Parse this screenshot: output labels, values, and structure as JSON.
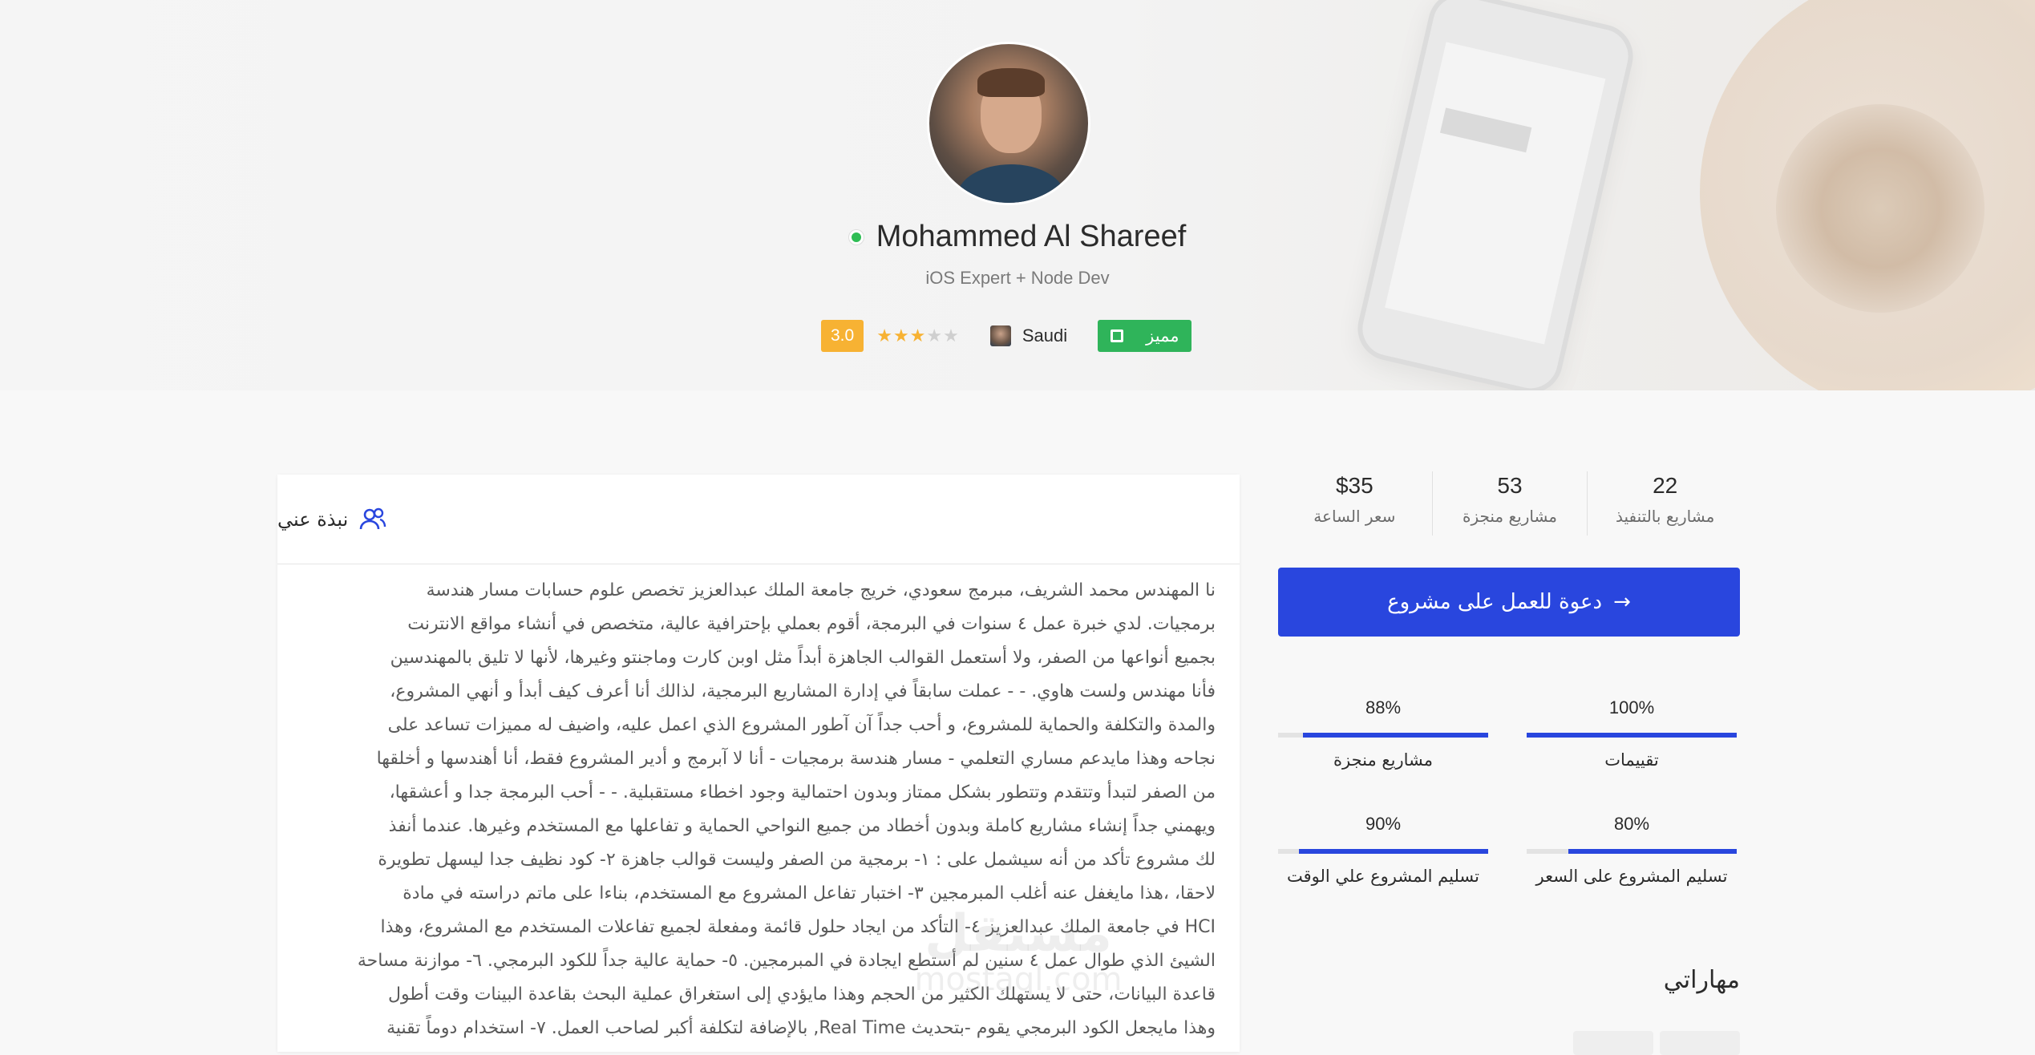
{
  "profile": {
    "name": "Mohammed Al Shareef",
    "title": "iOS Expert + Node Dev",
    "rating": "3.0",
    "stars_filled": 3,
    "stars_total": 5,
    "country": "Saudi",
    "badge": "مميز"
  },
  "about": {
    "title": "نبذة عني",
    "lines": [
      "نا المهندس محمد الشريف، مبرمج سعودي، خريج جامعة الملك عبدالعزيز تخصص علوم حسابات مسار هندسة",
      "برمجيات. لدي خبرة عمل ٤ سنوات في البرمجة، أقوم بعملي بإحترافية عالية، متخصص في أنشاء مواقع الانترنت",
      "بجميع أنواعها من الصفر، ولا أستعمل القوالب الجاهزة أبداً مثل اوبن كارت وماجنتو وغيرها، لأنها لا تليق بالمهندسين",
      "فأنا مهندس ولست هاوي. - - عملت سابقاً في إدارة المشاريع البرمجية، لذالك أنا أعرف كيف أبدأ و أنهي المشروع،",
      "والمدة والتكلفة والحماية للمشروع، و أحب جداً آن آطور المشروع الذي اعمل عليه، واضيف له مميزات تساعد على",
      "نجاحه وهذا مايدعم مساري التعلمي - مسار هندسة برمجيات - أنا لا آبرمج و أدير المشروع فقط، أنا أهندسها و أخلقها",
      "من الصفر لتبدأ وتتقدم وتتطور بشكل ممتاز وبدون احتمالية وجود اخطاء مستقبلية. - - أحب البرمجة جدا و أعشقها،",
      "ويهمني جداً إنشاء مشاريع كاملة وبدون أخطاد من جميع النواحي الحماية و تفاعلها مع المستخدم وغيرها. عندما أنفذ",
      "لك مشروع تأكد من أنه سيشمل على : ١- برمجية من الصفر وليست قوالب جاهزة ٢- كود نظيف جدا ليسهل تطويرة",
      "لاحقا، ،هذا مايغفل عنه أغلب المبرمجين ٣- اختبار تفاعل المشروع مع المستخدم، بناءا على ماتم دراسته في مادة",
      "HCI في جامعة الملك عبدالعزيز ٤- التأكد من ايجاد حلول قائمة ومفعلة لجميع تفاعلات المستخدم مع المشروع، وهذا",
      "الشيئ الذي طوال عمل ٤ سنين لم أستطع ايجادة في المبرمجين. ٥- حماية عالية جداً للكود البرمجي. ٦- موازنة مساحة",
      "قاعدة البيانات، حتى لا يستهلك الكثير من الحجم وهذا مايؤدي إلى استغراق عملية البحث بقاعدة البينات وقت أطول",
      "وهذا مايجعل الكود البرمجي يقوم -بتحديث Real Time, بالإضافة لتكلفة أكبر لصاحب العمل. ٧- استخدام دوماً تقنية"
    ]
  },
  "watermark": {
    "ar": "مستقل",
    "en": "mostaql.com"
  },
  "stats": [
    {
      "value": "22",
      "label": "مشاريع بالتنفيذ"
    },
    {
      "value": "53",
      "label": "مشاريع منجزة"
    },
    {
      "value": "$35",
      "label": "سعر الساعة"
    }
  ],
  "invite_button": {
    "arrow": "→",
    "label": "دعوة للعمل على مشروع"
  },
  "progress": [
    {
      "value": "100%",
      "fraction": 1.0,
      "label": "تقييمات"
    },
    {
      "value": "88%",
      "fraction": 0.88,
      "label": "مشاريع منجزة"
    },
    {
      "value": "80%",
      "fraction": 0.8,
      "label": "تسليم المشروع على السعر"
    },
    {
      "value": "90%",
      "fraction": 0.9,
      "label": "تسليم المشروع علي الوقت"
    }
  ],
  "skills": {
    "title": "مهاراتي"
  },
  "colors": {
    "primary": "#2946de",
    "rating": "#f7b233",
    "featured": "#2fb45a",
    "online": "#2ebd54"
  }
}
